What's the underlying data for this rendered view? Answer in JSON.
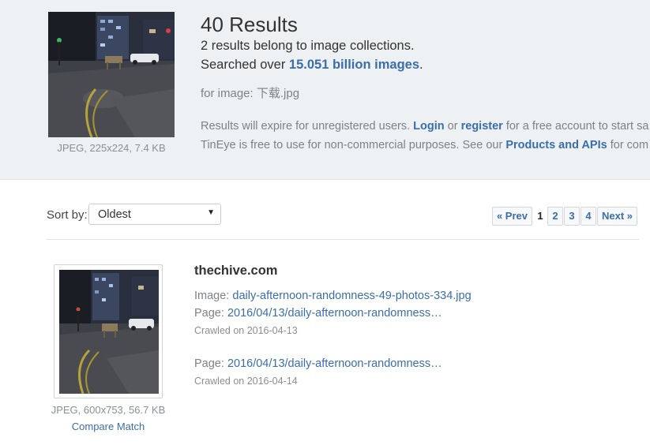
{
  "query": {
    "thumb_caption": "JPEG, 225x224, 7.4 KB",
    "results_title": "40 Results",
    "collections_text": "2 results belong to image collections.",
    "searched_prefix": "Searched over",
    "searched_link": "15.051 billion images",
    "searched_suffix": ".",
    "for_image_label": "for image: 下载.jpg",
    "note1_prefix": "Results will expire for unregistered users.",
    "login": "Login",
    "or": "or",
    "register": "register",
    "note1_suffix": "for a free account to start sa",
    "note2_prefix": "TinEye is free to use for non-commercial purposes. See our",
    "products_link": "Products and APIs",
    "note2_suffix": "for com"
  },
  "controls": {
    "sort_label": "Sort by:",
    "sort_value": "Oldest",
    "pager": {
      "prev": "« Prev",
      "current": "1",
      "pages": [
        "2",
        "3",
        "4"
      ],
      "next": "Next »"
    }
  },
  "result": {
    "domain": "thechive.com",
    "image_label": "Image:",
    "image_link": "daily-afternoon-randomness-49-photos-334.jpg",
    "page_label": "Page:",
    "page1_link": "2016/04/13/daily-afternoon-randomness…",
    "crawled1": "Crawled on 2016-04-13",
    "page2_link": "2016/04/13/daily-afternoon-randomness…",
    "crawled2": "Crawled on 2016-04-14",
    "thumb_caption": "JPEG, 600x753, 56.7 KB",
    "compare": "Compare Match"
  },
  "colors": {
    "accent_link": "#3a6eab",
    "band": "#eef1f3"
  }
}
